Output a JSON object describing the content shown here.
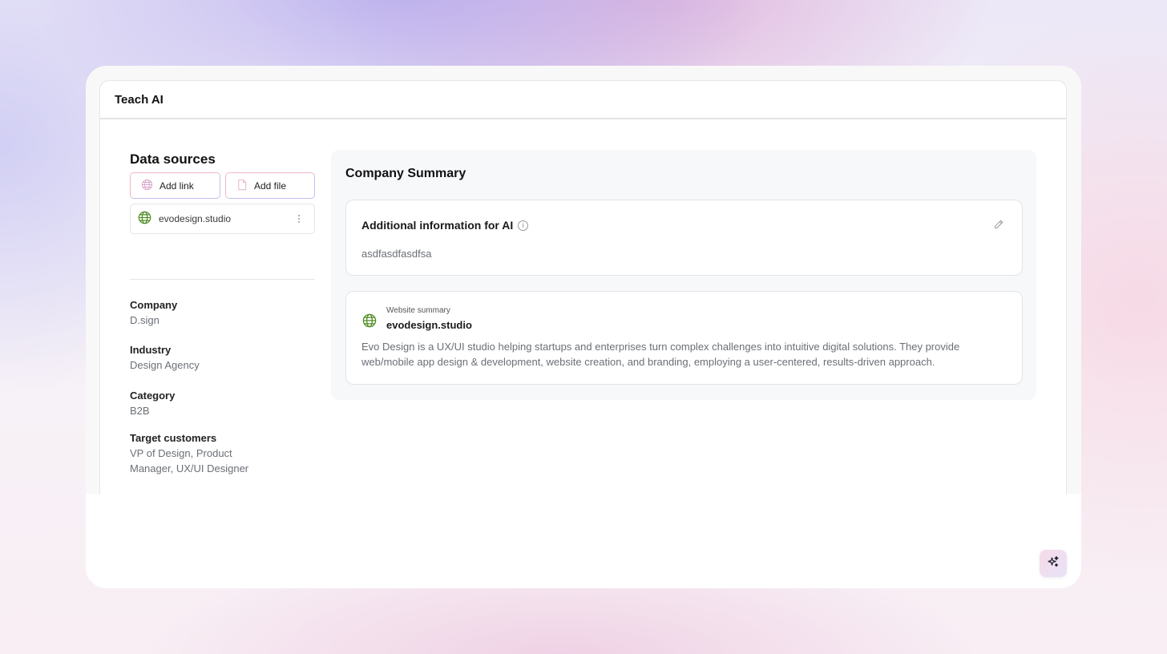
{
  "header": {
    "title": "Teach AI"
  },
  "data_sources": {
    "title": "Data sources",
    "add_link_label": "Add link",
    "add_file_label": "Add file",
    "items": [
      {
        "label": "evodesign.studio",
        "icon": "globe-icon"
      }
    ]
  },
  "company_info": [
    {
      "label": "Company",
      "value": "D.sign"
    },
    {
      "label": "Industry",
      "value": "Design Agency"
    },
    {
      "label": "Category",
      "value": "B2B"
    },
    {
      "label": "Target customers",
      "value": "VP of Design, Product Manager, UX/UI Designer"
    }
  ],
  "summary": {
    "title": "Company Summary",
    "ai_info": {
      "title": "Additional information for AI",
      "text": "asdfasdfasdfsa"
    },
    "website": {
      "subtitle": "Website summary",
      "name": "evodesign.studio",
      "description": "Evo Design is a UX/UI studio helping startups and enterprises turn complex challenges into intuitive digital solutions. They provide web/mobile app design & development, website creation, and branding, employing a user-centered, results-driven approach."
    }
  },
  "colors": {
    "globe": "#4b8a1f",
    "accent_pink": "#f0b7c6",
    "accent_purple": "#c4bdf2"
  }
}
